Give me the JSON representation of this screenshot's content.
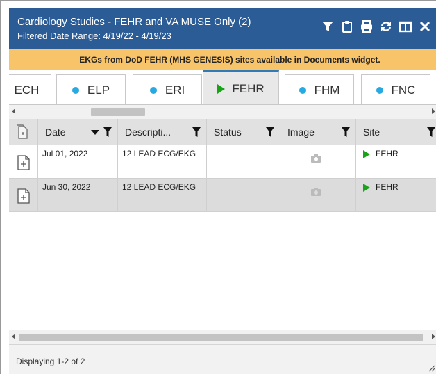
{
  "header": {
    "title": "Cardiology Studies - FEHR and VA MUSE Only (2)",
    "subtitle": "Filtered Date Range: 4/19/22 - 4/19/23",
    "icons": [
      "filter-icon",
      "clipboard-icon",
      "print-icon",
      "refresh-icon",
      "expand-icon",
      "close-icon"
    ],
    "color": "#2b5c96"
  },
  "banner": {
    "text": "EKGs from DoD FEHR (MHS GENESIS) sites available in Documents widget.",
    "color": "#f8c469"
  },
  "tabs": [
    {
      "label": "ECH",
      "indicator": "none"
    },
    {
      "label": "ELP",
      "indicator": "dot"
    },
    {
      "label": "ERI",
      "indicator": "dot"
    },
    {
      "label": "FEHR",
      "indicator": "play",
      "active": true
    },
    {
      "label": "FHM",
      "indicator": "dot"
    },
    {
      "label": "FNC",
      "indicator": "dot"
    }
  ],
  "table": {
    "columns": [
      "Date",
      "Descripti...",
      "Status",
      "Image",
      "Site"
    ],
    "rows": [
      {
        "date": "Jul 01, 2022",
        "description": "12 LEAD ECG/EKG",
        "status": "",
        "image": "camera-icon",
        "site": "FEHR"
      },
      {
        "date": "Jun 30, 2022",
        "description": "12 LEAD ECG/EKG",
        "status": "",
        "image": "camera-icon",
        "site": "FEHR"
      }
    ]
  },
  "footer": {
    "status": "Displaying 1-2 of 2"
  }
}
